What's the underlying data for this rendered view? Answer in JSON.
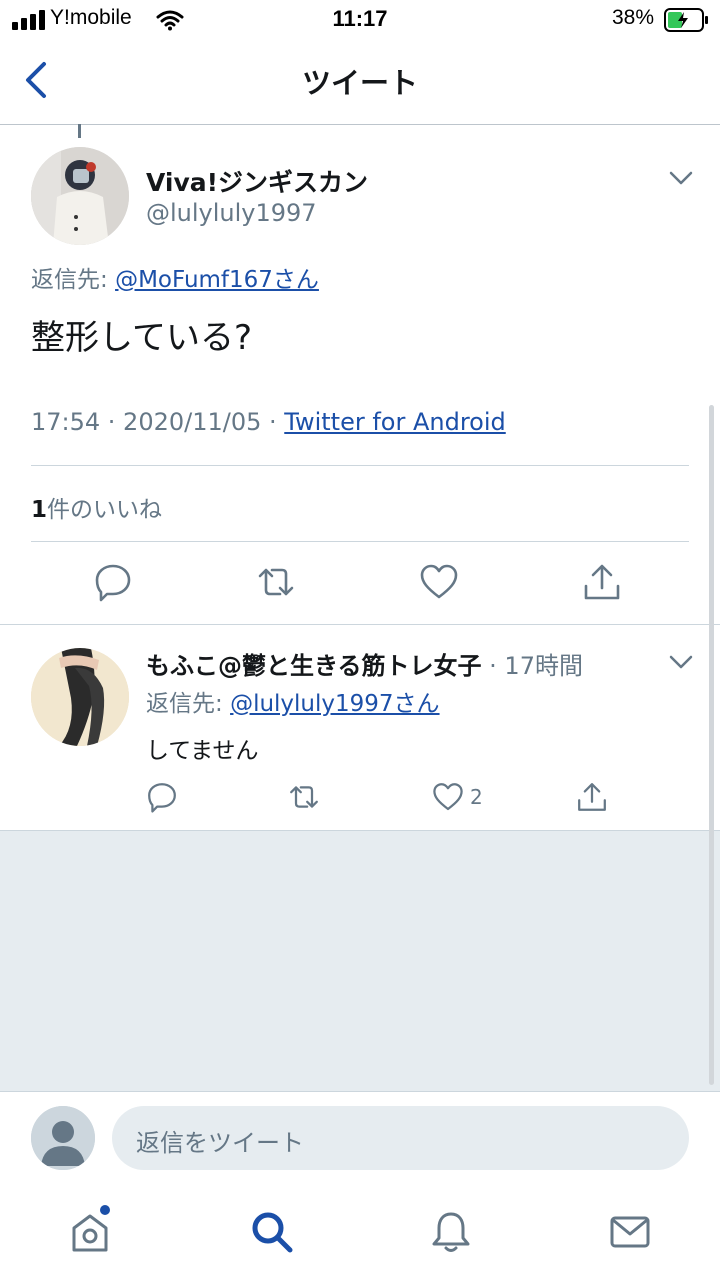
{
  "status_bar": {
    "carrier": "Y!mobile",
    "time": "11:17",
    "battery": "38%"
  },
  "header": {
    "title": "ツイート"
  },
  "main_tweet": {
    "display_name": "Viva!ジンギスカン",
    "handle": "@lulyluly1997",
    "reply_prefix": "返信先: ",
    "reply_to": "@MoFumf167さん",
    "text": "整形している?",
    "meta_time": "17:54 · 2020/11/05 · ",
    "meta_source": "Twitter for Android",
    "likes_count": "1",
    "likes_label": "件のいいね"
  },
  "reply_tweet": {
    "display_name": "もふこ@鬱と生きる筋トレ女子",
    "time": " · 17時間",
    "reply_prefix": "返信先: ",
    "reply_to": "@lulyluly1997さん",
    "text": "してません",
    "like_count": "2"
  },
  "compose": {
    "placeholder": "返信をツイート"
  },
  "colors": {
    "link": "#1b4fa8",
    "secondary_text": "#657786",
    "background_gray": "#e6ecf0"
  }
}
